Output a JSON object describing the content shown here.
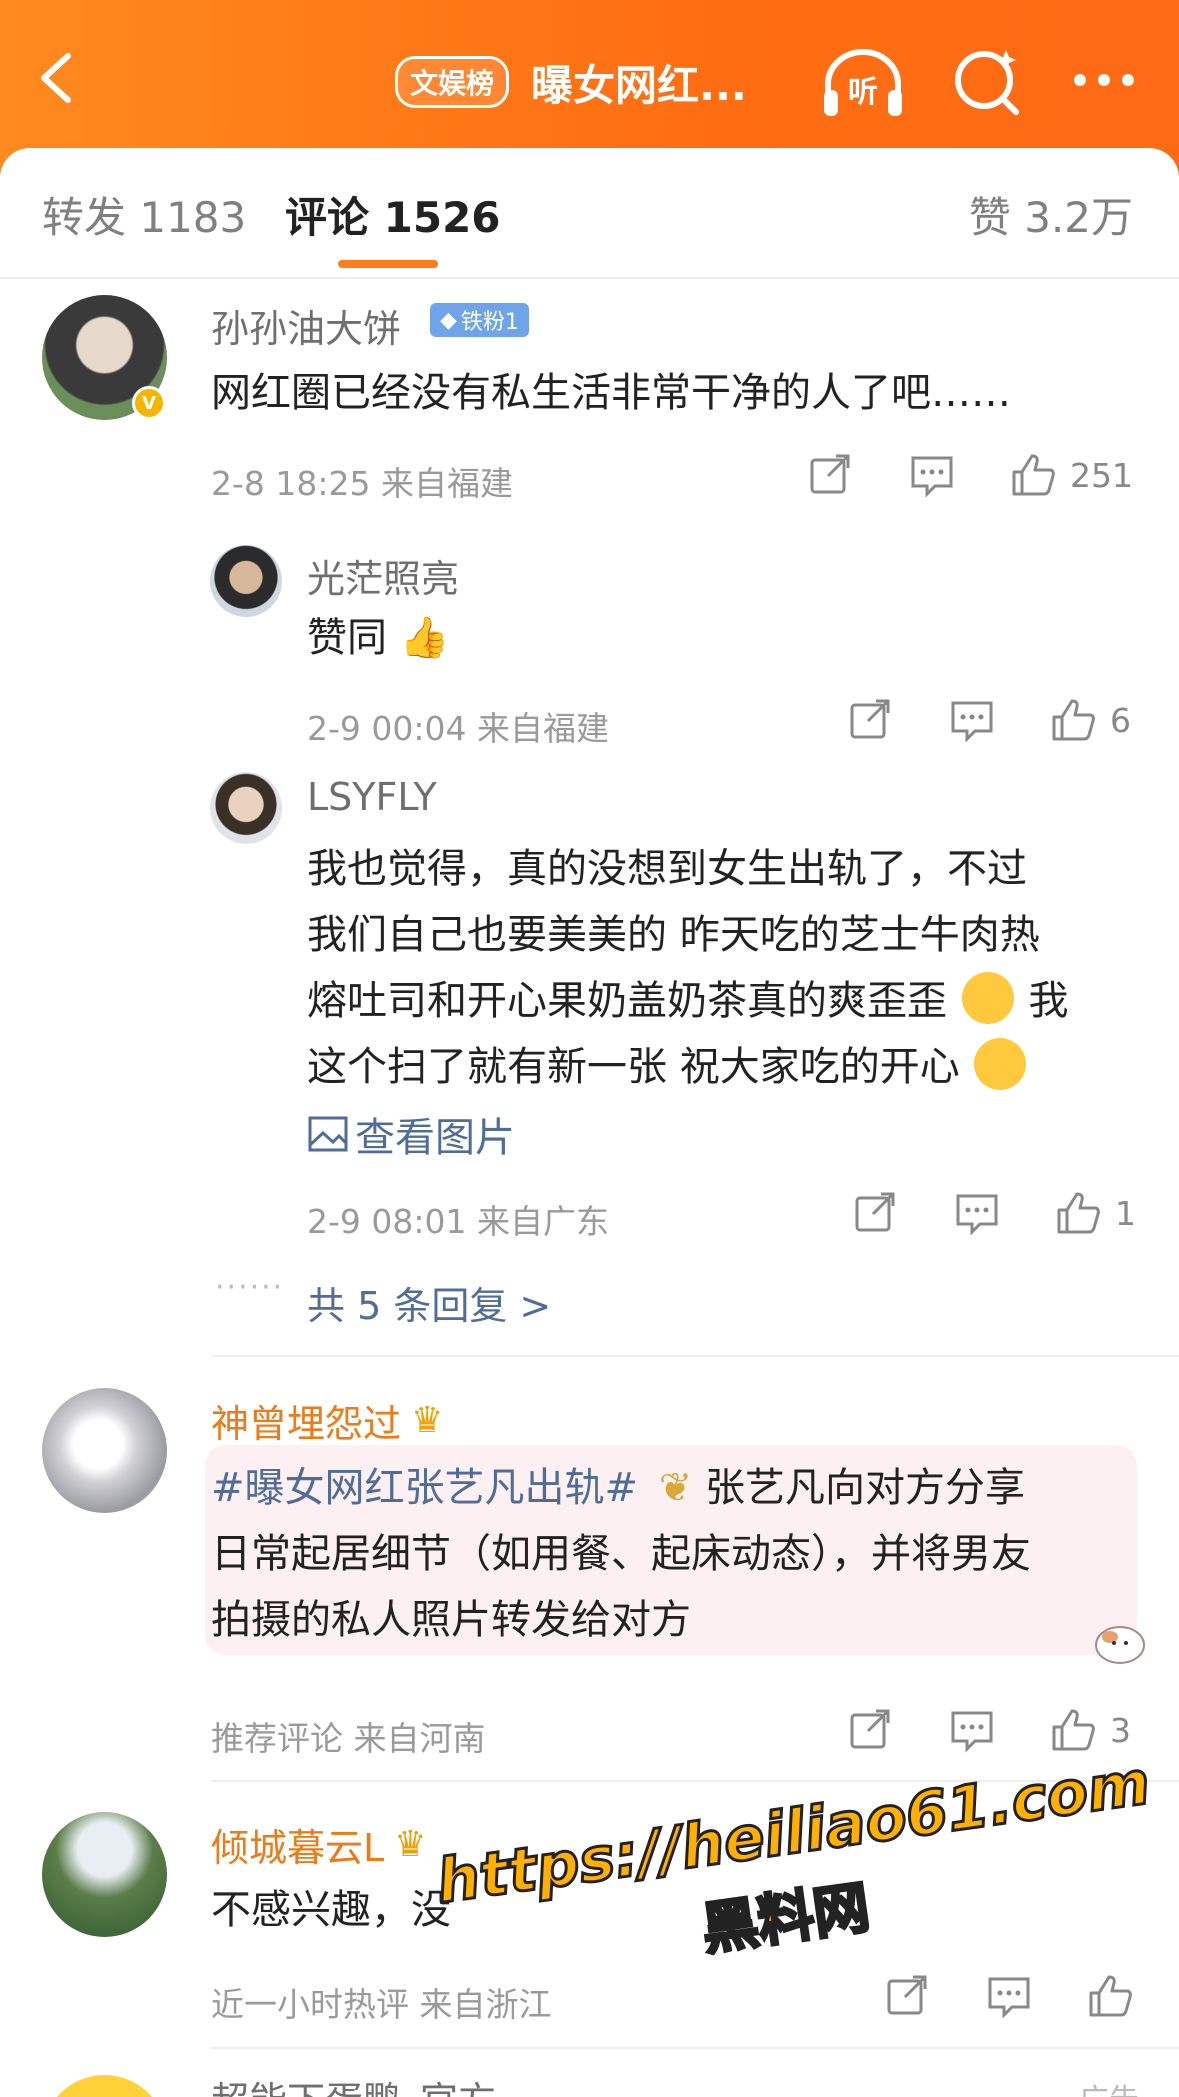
{
  "header": {
    "badge": "文娱榜",
    "title": "曝女网红...",
    "colors": {
      "gradient_start": "#ff8a1e",
      "gradient_end": "#ff6a14"
    }
  },
  "tabs": {
    "repost": "转发 1183",
    "comment": "评论 1526",
    "like": "赞 3.2万"
  },
  "comments": [
    {
      "user": "孙孙油大饼",
      "fan_badge": "铁粉1",
      "verified_mark": "V",
      "text": "网红圈已经没有私生活非常干净的人了吧……",
      "meta": "2-8 18:25 来自福建",
      "likes": "251",
      "replies": [
        {
          "user": "光茫照亮",
          "text": "赞同",
          "emoji": "👍",
          "meta": "2-9 00:04 来自福建",
          "likes": "6"
        },
        {
          "user": "LSYFLY",
          "lines": [
            "我也觉得，真的没想到女生出轨了，不过",
            "我们自己也要美美的 昨天吃的芝士牛肉热",
            "熔吐司和开心果奶盖奶茶真的爽歪歪",
            "这个扫了就有新一张 祝大家吃的开心"
          ],
          "line3_suffix": "我",
          "view_pic": "查看图片",
          "meta": "2-9 08:01 来自广东",
          "likes": "1"
        }
      ],
      "more_replies": "共 5 条回复 >",
      "dots": "······"
    },
    {
      "user": "神曾埋怨过",
      "hashtag": "#曝女网红张艺凡出轨#",
      "line1_tail": " 张艺凡向对方分享",
      "line2": "日常起居细节（如用餐、起床动态），并将男友",
      "line3": "拍摄的私人照片转发给对方",
      "meta": "推荐评论  来自河南",
      "likes": "3"
    },
    {
      "user": "倾城暮云L",
      "text": "不感兴趣，没",
      "meta": "近一小时热评  来自浙江",
      "likes": ""
    },
    {
      "user": "超能下蛋鹏_官方",
      "ad_label": "广告"
    }
  ],
  "watermark": {
    "line1": "https://heiliao61.com",
    "line2": "黑料网"
  }
}
